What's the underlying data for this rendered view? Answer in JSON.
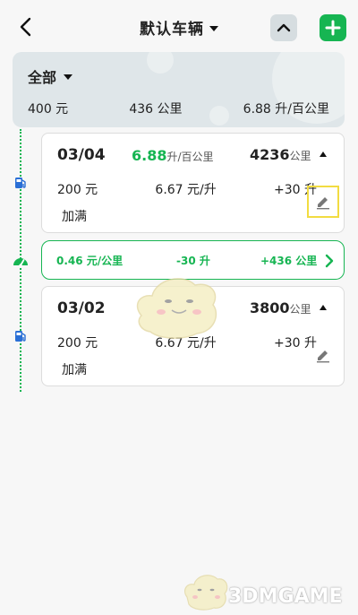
{
  "header": {
    "title": "默认车辆"
  },
  "summary": {
    "filter_label": "全部",
    "total_cost": "400 元",
    "total_distance": "436 公里",
    "avg_consumption": "6.88 升/百公里"
  },
  "records": [
    {
      "date": "03/04",
      "consumption": "6.88",
      "consumption_unit": "升/百公里",
      "odometer": "4236",
      "odometer_unit": "公里",
      "cost": "200 元",
      "unit_price": "6.67 元/升",
      "volume": "+30 升",
      "fill_status": "加满"
    },
    {
      "date": "03/02",
      "consumption": "",
      "consumption_unit": "",
      "odometer": "3800",
      "odometer_unit": "公里",
      "cost": "200 元",
      "unit_price": "6.67 元/升",
      "volume": "+30 升",
      "fill_status": "加满"
    }
  ],
  "stats": {
    "cost_per_km": "0.46 元/公里",
    "fuel_delta": "-30 升",
    "distance_delta": "+436 公里"
  },
  "watermark": "3DMGAME",
  "colors": {
    "accent": "#16b552",
    "summary_bg": "#dfe6e9",
    "highlight": "#f2dc41"
  },
  "icons": [
    "back-icon",
    "caret-down-icon",
    "chevron-up-icon",
    "plus-icon",
    "fuel-pump-icon",
    "speedometer-icon",
    "edit-pencil-icon",
    "chevron-right-icon"
  ]
}
